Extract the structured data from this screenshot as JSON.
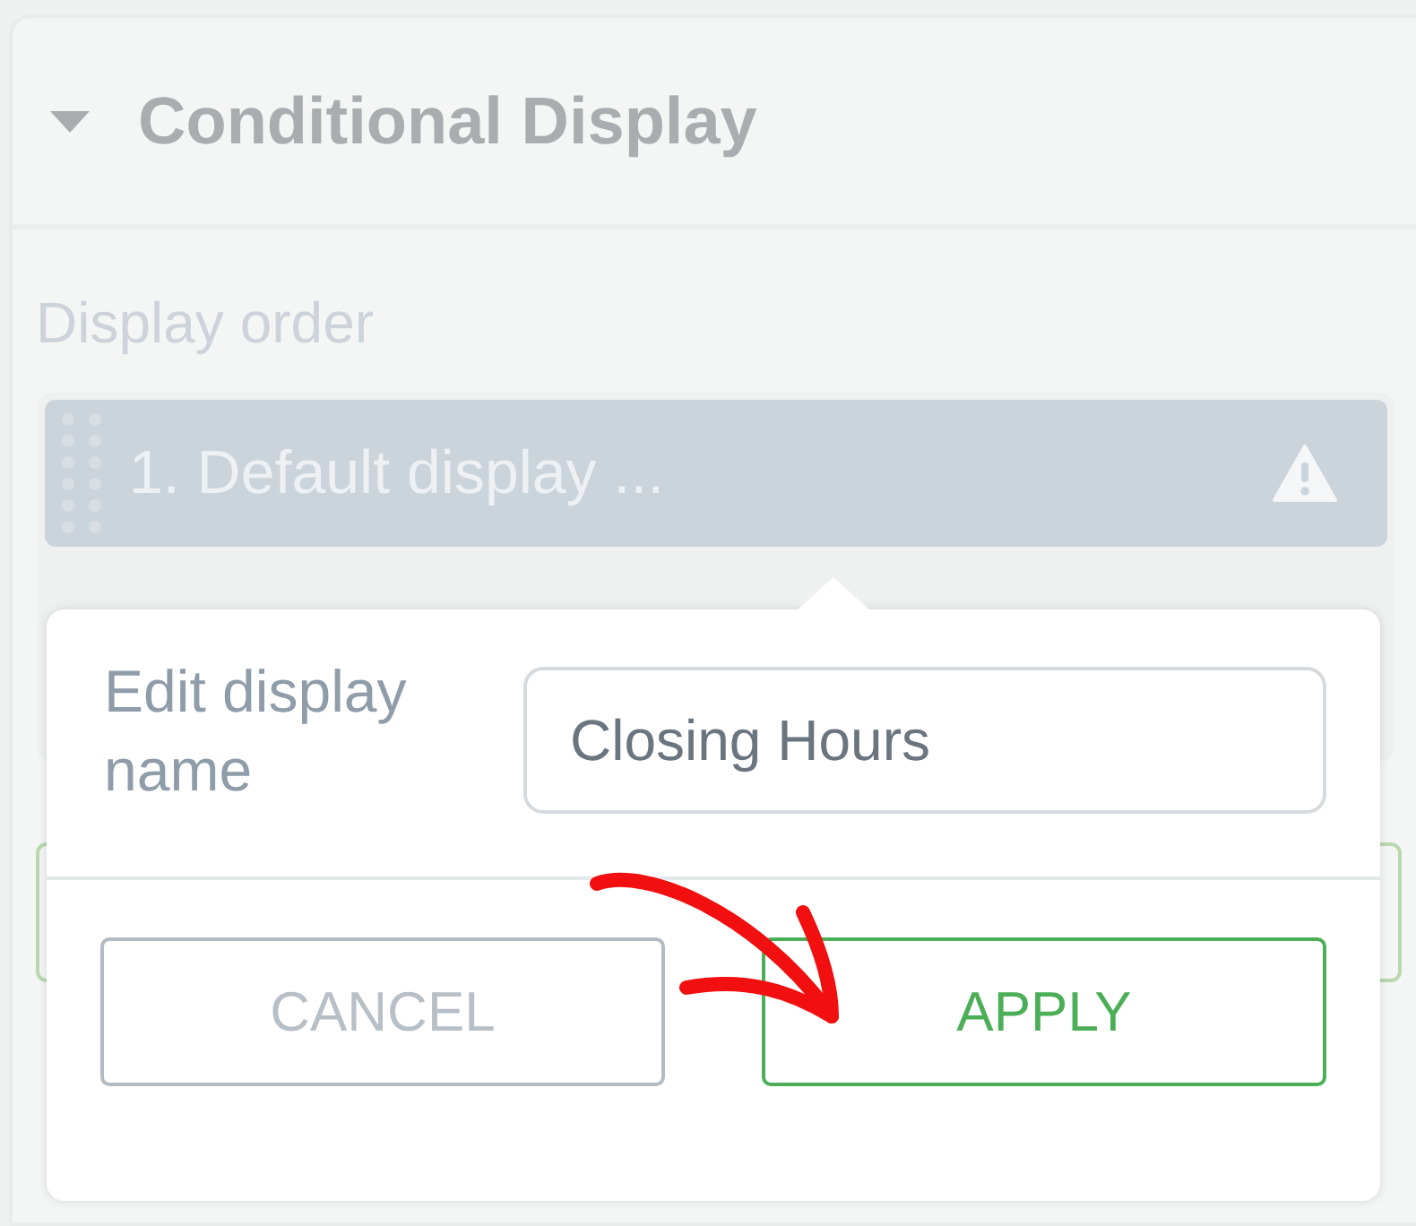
{
  "panel": {
    "title": "Conditional Display",
    "expanded": true
  },
  "display_order": {
    "label": "Display order",
    "items": [
      {
        "number": "1.",
        "name": "Default display ...",
        "warning": true
      }
    ]
  },
  "popover": {
    "label": "Edit display name",
    "input": {
      "value": "Closing Hours"
    },
    "buttons": [
      {
        "label": "CANCEL",
        "kind": "secondary"
      },
      {
        "label": "APPLY",
        "kind": "primary"
      }
    ]
  }
}
